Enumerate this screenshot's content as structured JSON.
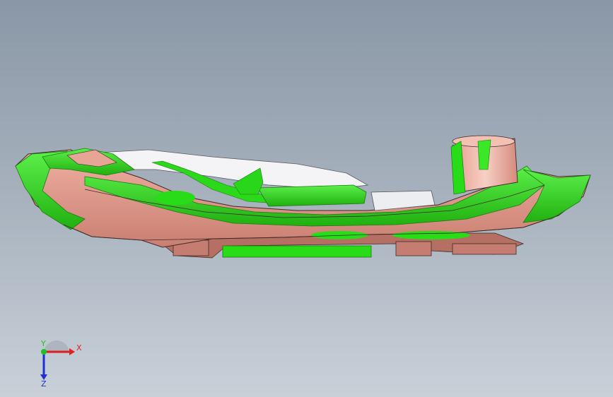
{
  "viewport": {
    "background_top": "#8a97a6",
    "background_bottom": "#c9d0d8"
  },
  "model": {
    "surface_colors": {
      "pink": "#e29a8c",
      "pink_dark": "#b97466",
      "green": "#28dc18",
      "green_dark": "#1ca512",
      "white": "#f4f4f6",
      "edge": "#3b2a26"
    }
  },
  "triad": {
    "x_label": "X",
    "y_label": "Y",
    "z_label": "Z",
    "x_color": "#e02020",
    "y_color": "#20c020",
    "z_color": "#2030d0"
  }
}
